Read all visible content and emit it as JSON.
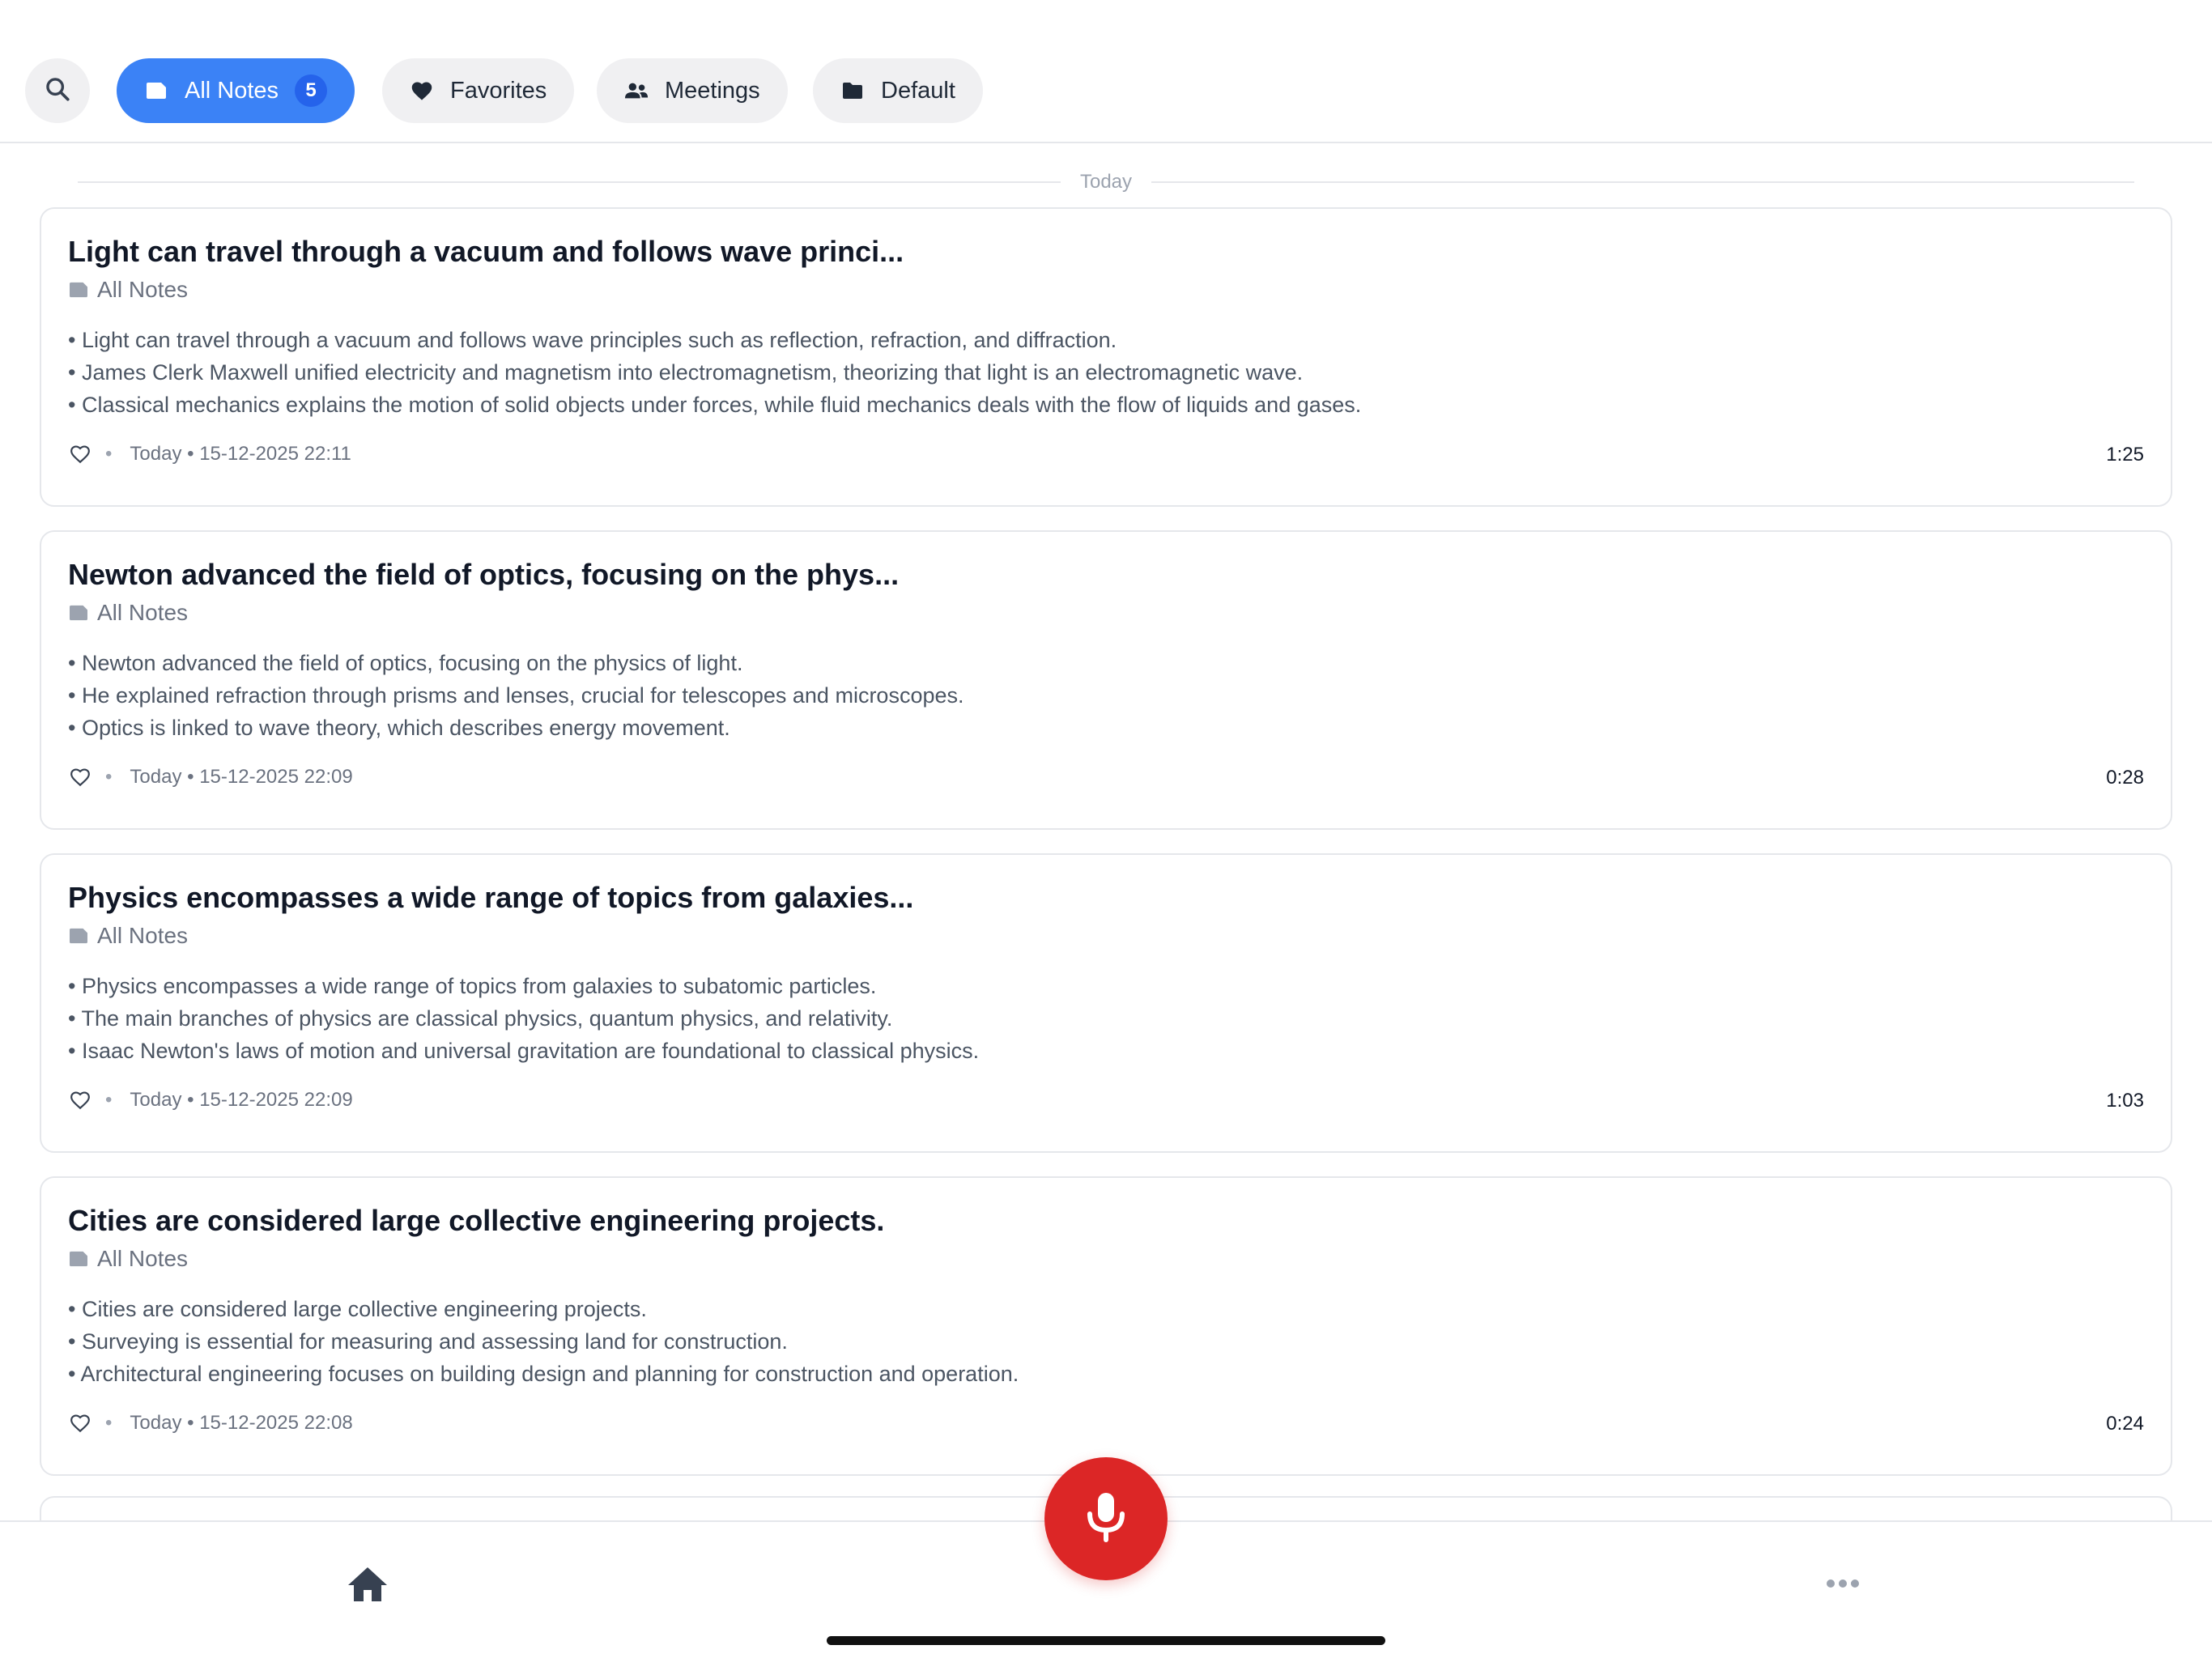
{
  "filters": {
    "search_icon": "search-icon",
    "chips": [
      {
        "label": "All Notes",
        "icon": "tag-icon",
        "count": "5",
        "active": true
      },
      {
        "label": "Favorites",
        "icon": "heart-icon",
        "active": false
      },
      {
        "label": "Meetings",
        "icon": "people-icon",
        "active": false
      },
      {
        "label": "Default",
        "icon": "folder-icon",
        "active": false
      }
    ]
  },
  "section": {
    "label": "Today"
  },
  "notes": [
    {
      "title": "Light can travel through a vacuum and follows wave princi...",
      "folder": "All Notes",
      "bullets": [
        "• Light can travel through a vacuum and follows wave principles such as reflection, refraction, and diffraction.",
        "• James Clerk Maxwell unified electricity and magnetism into electromagnetism, theorizing that light is an electromagnetic wave.",
        "• Classical mechanics explains the motion of solid objects under forces, while fluid mechanics deals with the flow of liquids and gases."
      ],
      "separator": "•",
      "timestamp": "Today • 15-12-2025 22:11",
      "duration": "1:25"
    },
    {
      "title": "Newton advanced the field of optics, focusing on the phys...",
      "folder": "All Notes",
      "bullets": [
        "• Newton advanced the field of optics, focusing on the physics of light.",
        "• He explained refraction through prisms and lenses, crucial for telescopes and microscopes.",
        "• Optics is linked to wave theory, which describes energy movement."
      ],
      "separator": "•",
      "timestamp": "Today • 15-12-2025 22:09",
      "duration": "0:28"
    },
    {
      "title": "Physics encompasses a wide range of topics from galaxies...",
      "folder": "All Notes",
      "bullets": [
        "• Physics encompasses a wide range of topics from galaxies to subatomic particles.",
        "• The main branches of physics are classical physics, quantum physics, and relativity.",
        "• Isaac Newton's laws of motion and universal gravitation are foundational to classical physics."
      ],
      "separator": "•",
      "timestamp": "Today • 15-12-2025 22:09",
      "duration": "1:03"
    },
    {
      "title": "Cities are considered large collective engineering projects.",
      "folder": "All Notes",
      "bullets": [
        "• Cities are considered large collective engineering projects.",
        "• Surveying is essential for measuring and assessing land for construction.",
        "• Architectural engineering focuses on building design and planning for construction and operation."
      ],
      "separator": "•",
      "timestamp": "Today • 15-12-2025 22:08",
      "duration": "0:24"
    }
  ],
  "bottom_bar": {
    "home_icon": "home-icon",
    "record_icon": "microphone-icon",
    "more_icon": "more-icon"
  },
  "colors": {
    "accent": "#3b82f6",
    "record": "#dc2626",
    "chip_background": "#f0f0f2"
  }
}
